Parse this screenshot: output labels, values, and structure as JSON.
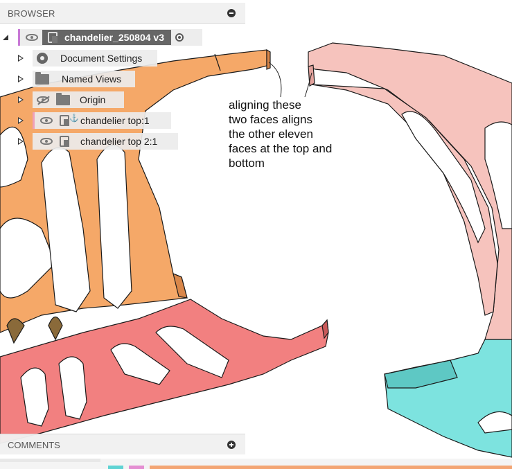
{
  "browser": {
    "title": "BROWSER",
    "collapse_icon": "minus-circle-icon",
    "root": {
      "label": "chandelier_250804 v3"
    },
    "items": [
      {
        "label": "Document Settings",
        "icon": "gear-icon"
      },
      {
        "label": "Named Views",
        "icon": "folder-icon"
      },
      {
        "label": "Origin",
        "icon": "folder-icon",
        "visibility": "hidden"
      },
      {
        "label": "chandelier top:1",
        "icon": "component-anchor-icon",
        "visibility": "visible"
      },
      {
        "label": "chandelier top 2:1",
        "icon": "component-icon",
        "visibility": "visible"
      }
    ]
  },
  "annotation": {
    "lines": [
      "aligning these",
      "two faces aligns",
      "the other eleven",
      "faces at the top and",
      "bottom"
    ]
  },
  "comments": {
    "title": "COMMENTS",
    "expand_icon": "plus-circle-icon"
  },
  "colors": {
    "orange_body": "#f5a868",
    "salmon_body": "#f28080",
    "pink_body": "#f6c3bd",
    "teal_body": "#7de3df",
    "panel_bg": "#f0f0f0",
    "root_chip": "#666666"
  }
}
